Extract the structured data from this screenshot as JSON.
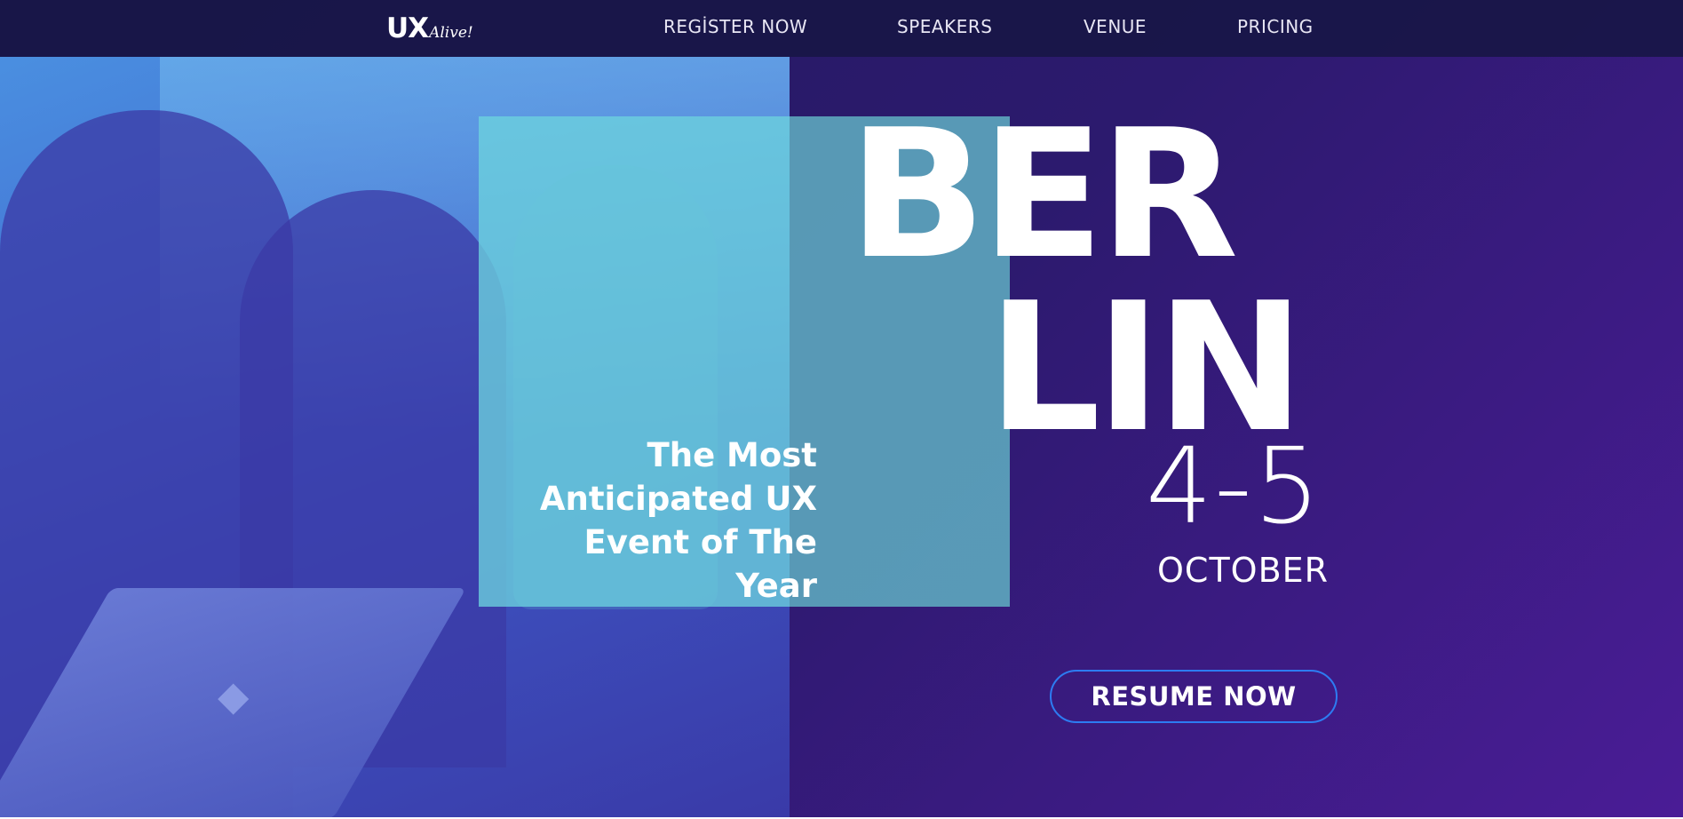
{
  "brand": {
    "logo_main": "UX",
    "logo_script": "Alive!"
  },
  "nav": {
    "items": [
      {
        "label": "REGİSTER NOW"
      },
      {
        "label": "SPEAKERS"
      },
      {
        "label": "VENUE"
      },
      {
        "label": "PRICING"
      }
    ]
  },
  "hero": {
    "tagline": "The Most Anticipated UX Event of The Year",
    "city_line_1": "BER",
    "city_line_2": "LIN",
    "dates": "4-5",
    "month": "OCTOBER",
    "cta_label": "RESUME NOW",
    "photo_icon": "apple-logo-icon"
  },
  "colors": {
    "background_start": "#221a5e",
    "background_end": "#4a1c96",
    "nav_background": "#181646",
    "photo_tint": "#4577d6",
    "overlay_cyan": "#6cd2de",
    "cta_border": "#2d7cf2",
    "text": "#ffffff"
  }
}
